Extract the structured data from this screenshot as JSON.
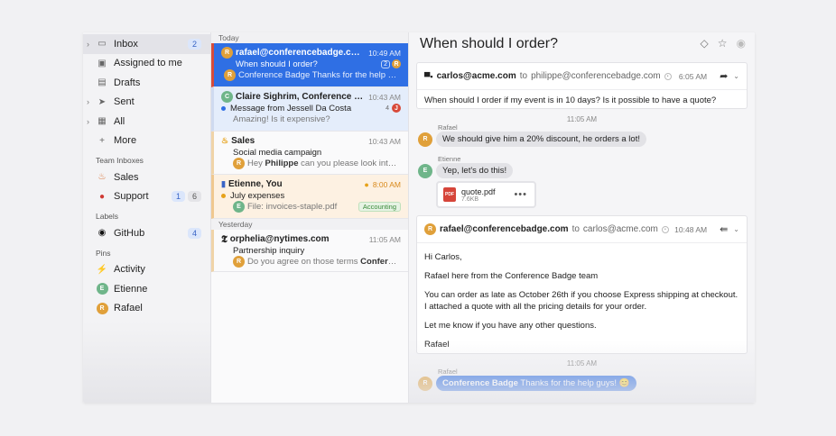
{
  "sidebar": {
    "items": [
      {
        "label": "Inbox",
        "badge": "2",
        "icon": "inbox-icon",
        "glyph": "▭"
      },
      {
        "label": "Assigned to me",
        "icon": "assigned-icon",
        "glyph": "▣"
      },
      {
        "label": "Drafts",
        "icon": "drafts-icon",
        "glyph": "▤"
      },
      {
        "label": "Sent",
        "icon": "sent-icon",
        "glyph": "➤"
      },
      {
        "label": "All",
        "icon": "all-icon",
        "glyph": "▦"
      },
      {
        "label": "More",
        "icon": "plus-icon",
        "glyph": "+"
      }
    ],
    "team_heading": "Team Inboxes",
    "team": [
      {
        "label": "Sales",
        "icon": "sales-icon",
        "glyph": "♨"
      },
      {
        "label": "Support",
        "badge1": "1",
        "badge2": "6",
        "icon": "support-icon",
        "glyph": "●"
      }
    ],
    "labels_heading": "Labels",
    "labels": [
      {
        "label": "GitHub",
        "badge": "4",
        "icon": "github-icon",
        "glyph": "◉"
      }
    ],
    "pins_heading": "Pins",
    "pins": [
      {
        "label": "Activity",
        "icon": "lightning-icon",
        "glyph": "⚡"
      },
      {
        "label": "Etienne",
        "icon": "avatar-etienne-icon",
        "glyph": "E"
      },
      {
        "label": "Rafael",
        "icon": "avatar-rafael-icon",
        "glyph": "R"
      }
    ]
  },
  "list": {
    "today": "Today",
    "yesterday": "Yesterday",
    "messages": [
      {
        "from": "rafael@conferencebadge.com, carl...",
        "time": "10:49 AM",
        "subject": "When should I order?",
        "count": "2",
        "preview": "Conference Badge Thanks for the help gu..."
      },
      {
        "from": "Claire Sighrim, Conference Badge",
        "time": "10:43 AM",
        "subject": "Message from Jessell Da Costa",
        "count": "4",
        "preview": "Amazing! Is it expensive?"
      },
      {
        "from": "Sales",
        "time": "10:43 AM",
        "subject": "Social media campaign",
        "preview_name": "Philippe",
        "preview_pre": "Hey ",
        "preview_post": " can you please look into this?"
      },
      {
        "from": "Etienne, You",
        "time": "8:00 AM",
        "subject": "July expenses",
        "preview": "File: invoices-staple.pdf",
        "tag": "Accounting"
      },
      {
        "from": "orphelia@nytimes.com",
        "time": "11:05 AM",
        "subject": "Partnership inquiry",
        "preview_pre": "Do you agree on those terms ",
        "preview_name": "Conference ..."
      }
    ]
  },
  "detail": {
    "subject": "When should I order?",
    "email1": {
      "sender": "carlos@acme.com",
      "to_word": "to",
      "to": "philippe@conferencebadge.com",
      "time": "6:05 AM",
      "body": "When should I order if my event is in 10 days? Is it possible to have a quote?"
    },
    "chat1_time": "11:05 AM",
    "rafael_name": "Rafael",
    "rafael_msg": "We should give him a 20% discount, he orders a lot!",
    "etienne_name": "Etienne",
    "etienne_msg": "Yep, let's do this!",
    "attachment": {
      "name": "quote.pdf",
      "size": "7.6KB",
      "badge": "PDF"
    },
    "email2": {
      "sender": "rafael@conferencebadge.com",
      "to_word": "to",
      "to": "carlos@acme.com",
      "time": "10:48 AM",
      "greeting": "Hi Carlos,",
      "intro": "Rafael here from the Conference Badge team",
      "para": "You can order as late as October 26th if you choose Express shipping at checkout. I attached a quote with all the pricing details for your order.",
      "closing": "Let me know if you have any other questions.",
      "signature": "Rafael"
    },
    "chat2_time": "11:05 AM",
    "rafael_name2": "Rafael",
    "final_bold": "Conference Badge",
    "final_rest": " Thanks for the help guys! 😊"
  },
  "colors": {
    "accent": "#2f6fe4",
    "selected_border": "#d64c3b"
  }
}
